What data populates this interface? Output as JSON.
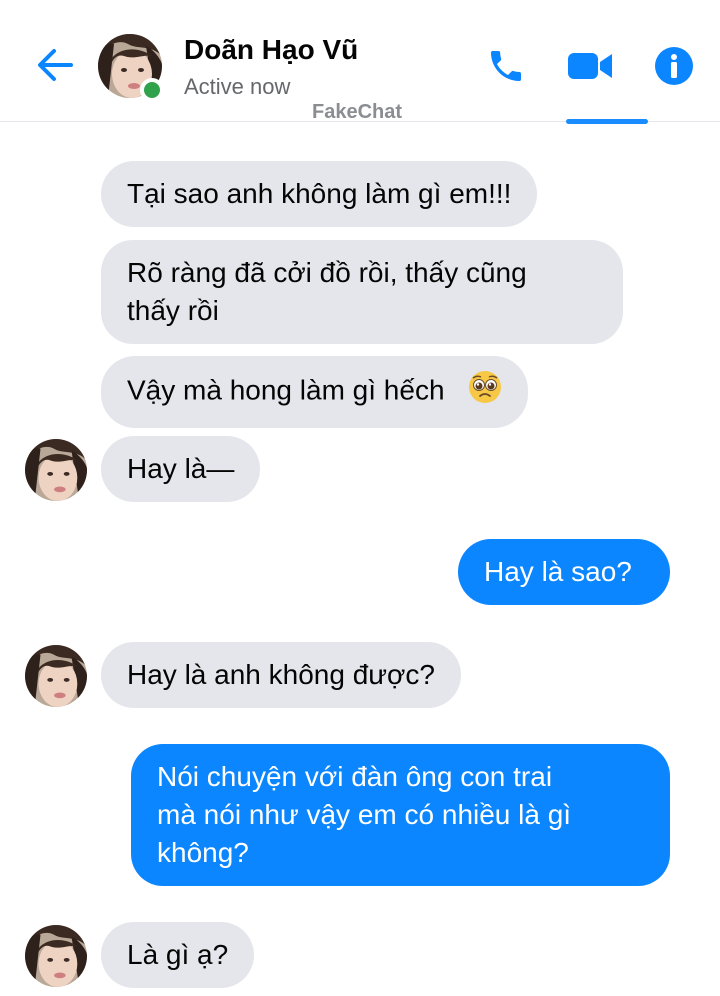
{
  "header": {
    "contact_name": "Doãn Hạo Vũ",
    "status": "Active now",
    "watermark": "FakeChat",
    "icons": [
      "back-arrow-icon",
      "phone-icon",
      "video-camera-icon",
      "info-icon"
    ],
    "accent_color": "#0b86ff",
    "presence_color": "#31a24c"
  },
  "messages": [
    {
      "direction": "incoming",
      "lines": [
        "Tại sao anh không làm gì em!!!"
      ]
    },
    {
      "direction": "incoming",
      "lines": [
        "Rõ ràng đã cởi đồ rồi, thấy cũng",
        "thấy rồi"
      ]
    },
    {
      "direction": "incoming",
      "lines": [
        "Vậy mà hong làm gì hếch"
      ],
      "emoji": "pleading-face-icon"
    },
    {
      "direction": "incoming",
      "lines": [
        "Hay là—"
      ],
      "avatar": true
    },
    {
      "direction": "outgoing",
      "lines": [
        "Hay là sao?"
      ]
    },
    {
      "direction": "incoming",
      "lines": [
        "Hay là anh không được?"
      ],
      "avatar": true
    },
    {
      "direction": "outgoing",
      "lines": [
        "Nói chuyện với đàn ông con trai",
        "mà nói như vậy em có nhiều là gì",
        "không?"
      ]
    },
    {
      "direction": "incoming",
      "lines": [
        "Là gì ạ?"
      ],
      "avatar": true
    }
  ],
  "colors": {
    "incoming_bubble": "#e4e6eb",
    "outgoing_bubble": "#0b86ff"
  }
}
